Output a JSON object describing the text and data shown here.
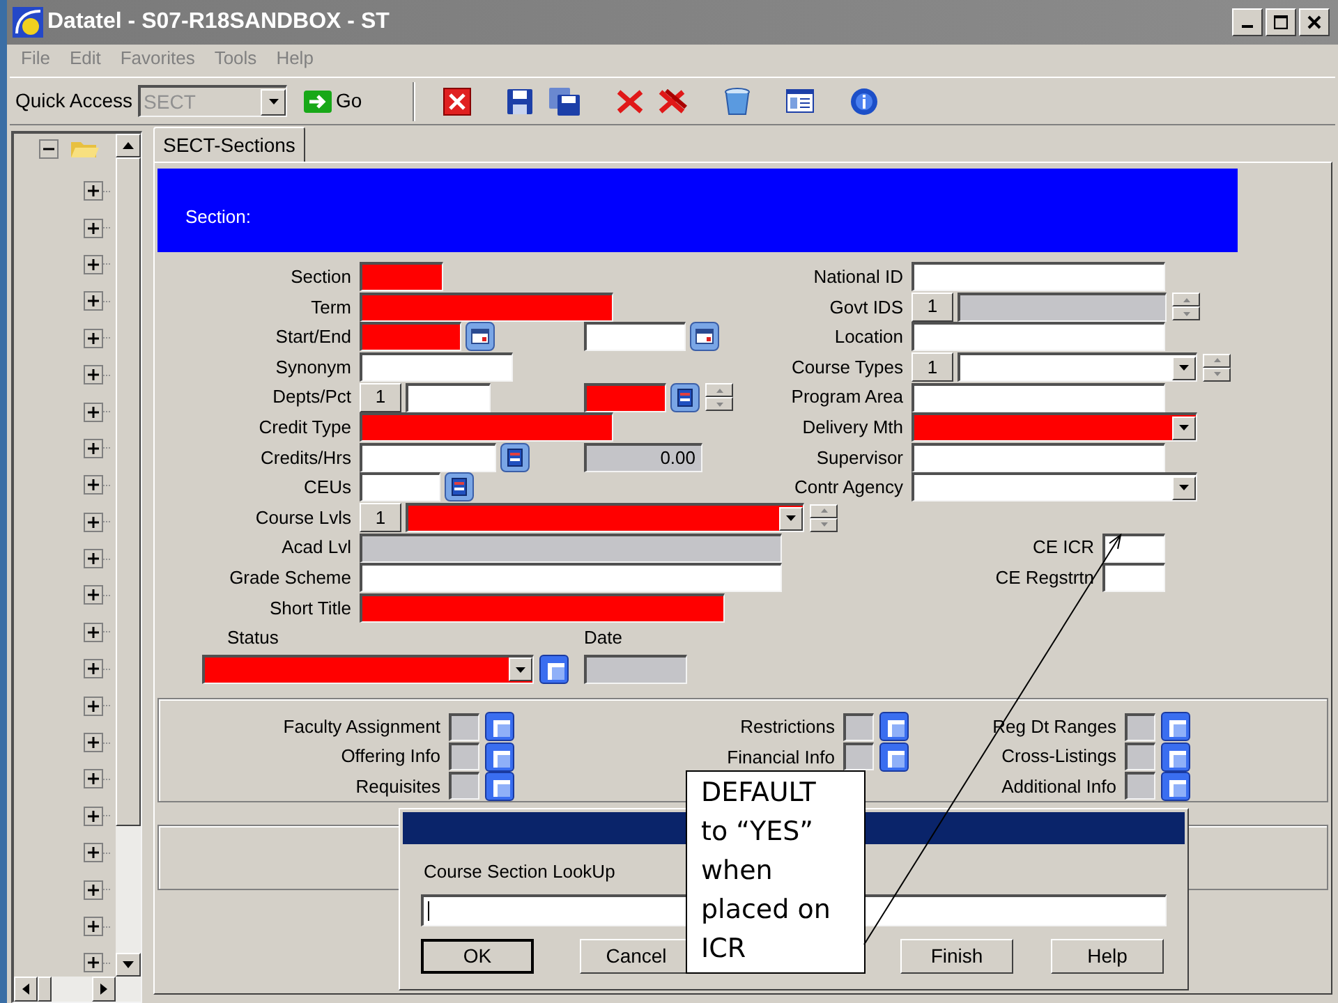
{
  "window": {
    "title": "Datatel - S07-R18SANDBOX - ST"
  },
  "menu": [
    {
      "label": "File"
    },
    {
      "label": "Edit"
    },
    {
      "label": "Favorites"
    },
    {
      "label": "Tools"
    },
    {
      "label": "Help"
    }
  ],
  "toolbar": {
    "quick_access_label": "Quick Access",
    "quick_access_value": "SECT",
    "go_label": "Go"
  },
  "tree": {
    "expanded": true,
    "children": [
      {
        "expanded": false
      },
      {
        "expanded": false
      },
      {
        "expanded": false
      },
      {
        "expanded": false
      },
      {
        "expanded": false
      },
      {
        "expanded": false
      },
      {
        "expanded": false
      },
      {
        "expanded": false
      },
      {
        "expanded": false
      },
      {
        "expanded": false
      },
      {
        "expanded": false
      },
      {
        "expanded": false
      },
      {
        "expanded": false
      },
      {
        "expanded": false
      },
      {
        "expanded": false
      },
      {
        "expanded": false
      },
      {
        "expanded": false
      },
      {
        "expanded": false
      },
      {
        "expanded": false
      },
      {
        "expanded": false
      },
      {
        "expanded": false
      },
      {
        "expanded": false
      }
    ]
  },
  "tab": {
    "label": "SECT-Sections",
    "selected": true
  },
  "form": {
    "header": "Section:",
    "left_fields": [
      {
        "label": "Section",
        "parts": [
          {
            "kind": "box",
            "required": true,
            "disabled": false
          }
        ]
      },
      {
        "label": "Term",
        "parts": [
          {
            "kind": "box",
            "required": true,
            "disabled": false
          }
        ]
      },
      {
        "label": "Start/End",
        "parts": [
          {
            "kind": "box",
            "required": true,
            "disabled": false
          },
          {
            "kind": "calendar"
          }
        ],
        "extra": [
          {
            "kind": "box",
            "required": false,
            "disabled": false
          },
          {
            "kind": "calendar"
          }
        ]
      },
      {
        "label": "Synonym",
        "parts": [
          {
            "kind": "box",
            "required": false,
            "disabled": false
          }
        ]
      },
      {
        "label": "Depts/Pct",
        "parts": [
          {
            "kind": "counter",
            "value": "1"
          },
          {
            "kind": "box",
            "required": false,
            "disabled": false
          }
        ],
        "extra": [
          {
            "kind": "box",
            "required": true,
            "disabled": false
          },
          {
            "kind": "detail"
          },
          {
            "kind": "spinner"
          }
        ]
      },
      {
        "label": "Credit Type",
        "parts": [
          {
            "kind": "box",
            "required": true,
            "disabled": false
          }
        ]
      },
      {
        "label": "Credits/Hrs",
        "parts": [
          {
            "kind": "box",
            "required": false,
            "disabled": false
          },
          {
            "kind": "detail"
          }
        ],
        "extra": [
          {
            "kind": "box",
            "disabled": true,
            "value": "0.00"
          }
        ]
      },
      {
        "label": "CEUs",
        "parts": [
          {
            "kind": "box",
            "required": false,
            "disabled": false
          },
          {
            "kind": "detail"
          }
        ]
      },
      {
        "label": "Course Lvls",
        "parts": [
          {
            "kind": "counter",
            "value": "1"
          },
          {
            "kind": "dropdown",
            "required": true
          },
          {
            "kind": "spinner"
          }
        ]
      },
      {
        "label": "Acad Lvl",
        "parts": [
          {
            "kind": "box",
            "disabled": true
          }
        ]
      },
      {
        "label": "Grade Scheme",
        "parts": [
          {
            "kind": "box",
            "required": false,
            "disabled": false
          }
        ]
      },
      {
        "label": "Short Title",
        "parts": [
          {
            "kind": "box",
            "required": true,
            "disabled": false
          }
        ]
      }
    ],
    "right_fields": [
      {
        "label": "National ID",
        "parts": [
          {
            "kind": "box",
            "required": false,
            "disabled": false
          }
        ]
      },
      {
        "label": "Govt IDS",
        "parts": [
          {
            "kind": "counter",
            "value": "1"
          },
          {
            "kind": "box",
            "disabled": true
          },
          {
            "kind": "spinner"
          }
        ]
      },
      {
        "label": "Location",
        "parts": [
          {
            "kind": "box",
            "required": false,
            "disabled": false
          }
        ]
      },
      {
        "label": "Course Types",
        "parts": [
          {
            "kind": "counter",
            "value": "1"
          },
          {
            "kind": "dropdown",
            "required": false
          },
          {
            "kind": "spinner"
          }
        ]
      },
      {
        "label": "Program Area",
        "parts": [
          {
            "kind": "box",
            "required": false,
            "disabled": false
          }
        ]
      },
      {
        "label": "Delivery Mth",
        "parts": [
          {
            "kind": "dropdown",
            "required": true
          }
        ]
      },
      {
        "label": "Supervisor",
        "parts": [
          {
            "kind": "box",
            "required": false,
            "disabled": false
          }
        ]
      },
      {
        "label": "Contr Agency",
        "parts": [
          {
            "kind": "dropdown",
            "required": false
          }
        ]
      }
    ],
    "ce_fields": [
      {
        "label": "CE ICR",
        "parts": [
          {
            "kind": "box",
            "required": false,
            "disabled": false
          }
        ]
      },
      {
        "label": "CE Regstrtn",
        "parts": [
          {
            "kind": "box",
            "required": false,
            "disabled": false
          }
        ]
      }
    ],
    "status": {
      "label": "Status",
      "required": true,
      "date_label": "Date"
    }
  },
  "links": [
    [
      {
        "label": "Faculty Assignment"
      },
      {
        "label": "Offering Info"
      },
      {
        "label": "Requisites"
      }
    ],
    [
      {
        "label": "Restrictions"
      },
      {
        "label": "Financial Info"
      }
    ],
    [
      {
        "label": "Reg Dt Ranges"
      },
      {
        "label": "Cross-Listings"
      },
      {
        "label": "Additional Info"
      }
    ]
  ],
  "dialog": {
    "label": "Course Section LookUp",
    "buttons": [
      {
        "label": "OK",
        "default": true
      },
      {
        "label": "Cancel",
        "default": false
      },
      {
        "label": "Finish",
        "default": false
      },
      {
        "label": "Help",
        "default": false
      }
    ]
  },
  "callout": {
    "text": "DEFAULT to “YES” when placed on ICR"
  }
}
